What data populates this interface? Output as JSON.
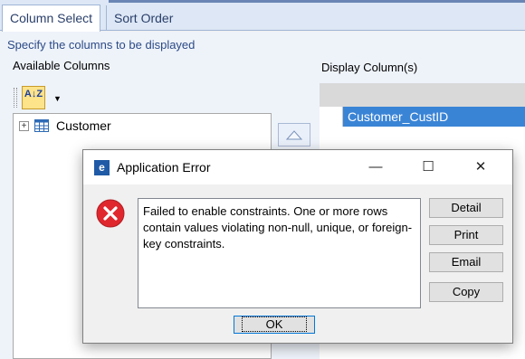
{
  "tabs": [
    {
      "label": "Column Select",
      "active": true
    },
    {
      "label": "Sort Order",
      "active": false
    }
  ],
  "hint": "Specify the columns to be displayed",
  "available": {
    "header": "Available Columns",
    "sort_button_label": "A↓Z",
    "tree_items": [
      {
        "label": "Customer",
        "expander": "+"
      }
    ]
  },
  "display": {
    "header": "Display Column(s)",
    "rows": [
      {
        "value": "Customer_CustID",
        "selected": true
      }
    ]
  },
  "dialog": {
    "title": "Application Error",
    "app_icon_letter": "e",
    "message": "Failed to enable constraints. One or more rows contain values violating non-null, unique, or foreign-key constraints.",
    "buttons": {
      "detail": "Detail",
      "print": "Print",
      "email": "Email",
      "copy": "Copy",
      "ok": "OK"
    },
    "window_controls": {
      "minimize": "—",
      "maximize": "☐",
      "close": "✕"
    }
  },
  "colors": {
    "selection": "#3a84d6",
    "error": "#e0272e",
    "accent": "#1f5aa6"
  }
}
